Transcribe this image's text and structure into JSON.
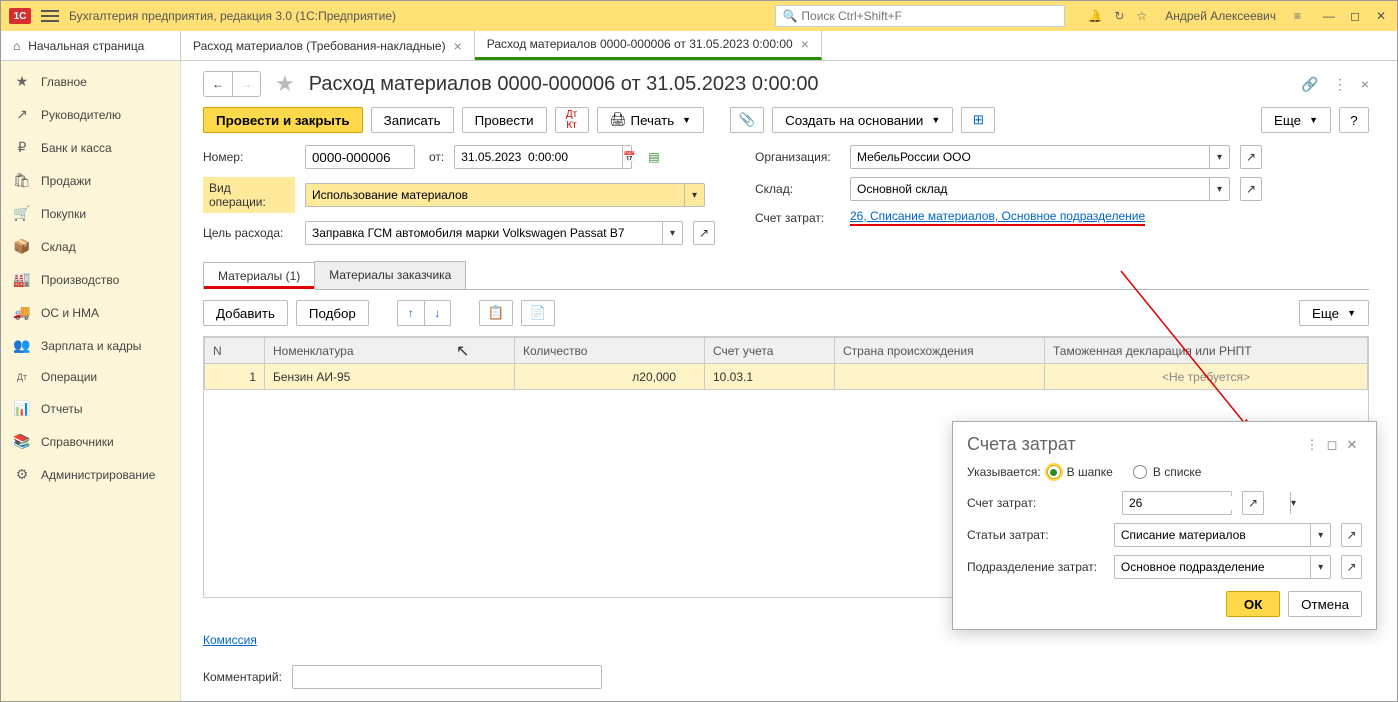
{
  "app_title": "Бухгалтерия предприятия, редакция 3.0  (1С:Предприятие)",
  "search_placeholder": "Поиск Ctrl+Shift+F",
  "user_name": "Андрей Алексеевич",
  "tabs": {
    "home": "Начальная страница",
    "t1": "Расход материалов (Требования-накладные)",
    "t2": "Расход материалов 0000-000006 от 31.05.2023 0:00:00"
  },
  "sidebar": [
    {
      "icon": "★",
      "label": "Главное"
    },
    {
      "icon": "↗",
      "label": "Руководителю"
    },
    {
      "icon": "₽",
      "label": "Банк и касса"
    },
    {
      "icon": "🛍",
      "label": "Продажи"
    },
    {
      "icon": "🛒",
      "label": "Покупки"
    },
    {
      "icon": "📦",
      "label": "Склад"
    },
    {
      "icon": "🏭",
      "label": "Производство"
    },
    {
      "icon": "🚚",
      "label": "ОС и НМА"
    },
    {
      "icon": "👥",
      "label": "Зарплата и кадры"
    },
    {
      "icon": "Дт",
      "label": "Операции"
    },
    {
      "icon": "📊",
      "label": "Отчеты"
    },
    {
      "icon": "📚",
      "label": "Справочники"
    },
    {
      "icon": "⚙",
      "label": "Администрирование"
    }
  ],
  "page_title": "Расход материалов 0000-000006 от 31.05.2023 0:00:00",
  "buttons": {
    "post_close": "Провести и закрыть",
    "write": "Записать",
    "post": "Провести",
    "print": "Печать",
    "create_based": "Создать на основании",
    "more": "Еще",
    "help": "?",
    "add": "Добавить",
    "pick": "Подбор",
    "ok": "ОК",
    "cancel": "Отмена"
  },
  "labels": {
    "number": "Номер:",
    "from": "от:",
    "op_type": "Вид операции:",
    "purpose": "Цель расхода:",
    "org": "Организация:",
    "warehouse": "Склад:",
    "cost_acct": "Счет затрат:",
    "commission": "Комиссия",
    "comment": "Комментарий:",
    "specified": "Указывается:",
    "in_header": "В шапке",
    "in_list": "В списке",
    "cost_acct2": "Счет затрат:",
    "cost_item": "Статьи затрат:",
    "dept": "Подразделение затрат:"
  },
  "values": {
    "number": "0000-000006",
    "date": "31.05.2023  0:00:00",
    "op_type": "Использование материалов",
    "purpose": "Заправка ГСМ автомобиля марки Volkswagen Passat B7",
    "org": "МебельРоссии ООО",
    "warehouse": "Основной склад",
    "cost_link": "26, Списание материалов, Основное подразделение",
    "acct": "26",
    "item": "Списание материалов",
    "dept": "Основное подразделение"
  },
  "doc_tabs": {
    "t1": "Материалы (1)",
    "t2": "Материалы заказчика"
  },
  "grid": {
    "headers": {
      "n": "N",
      "nom": "Номенклатура",
      "qty": "Количество",
      "acct": "Счет учета",
      "country": "Страна происхождения",
      "cust": "Таможенная декларация или РНПТ"
    },
    "rows": [
      {
        "n": "1",
        "nom": "Бензин АИ-95",
        "qty": "20,000",
        "unit": "л",
        "acct": "10.03.1",
        "country": "",
        "cust": "<Не требуется>"
      }
    ]
  },
  "popup_title": "Счета затрат"
}
